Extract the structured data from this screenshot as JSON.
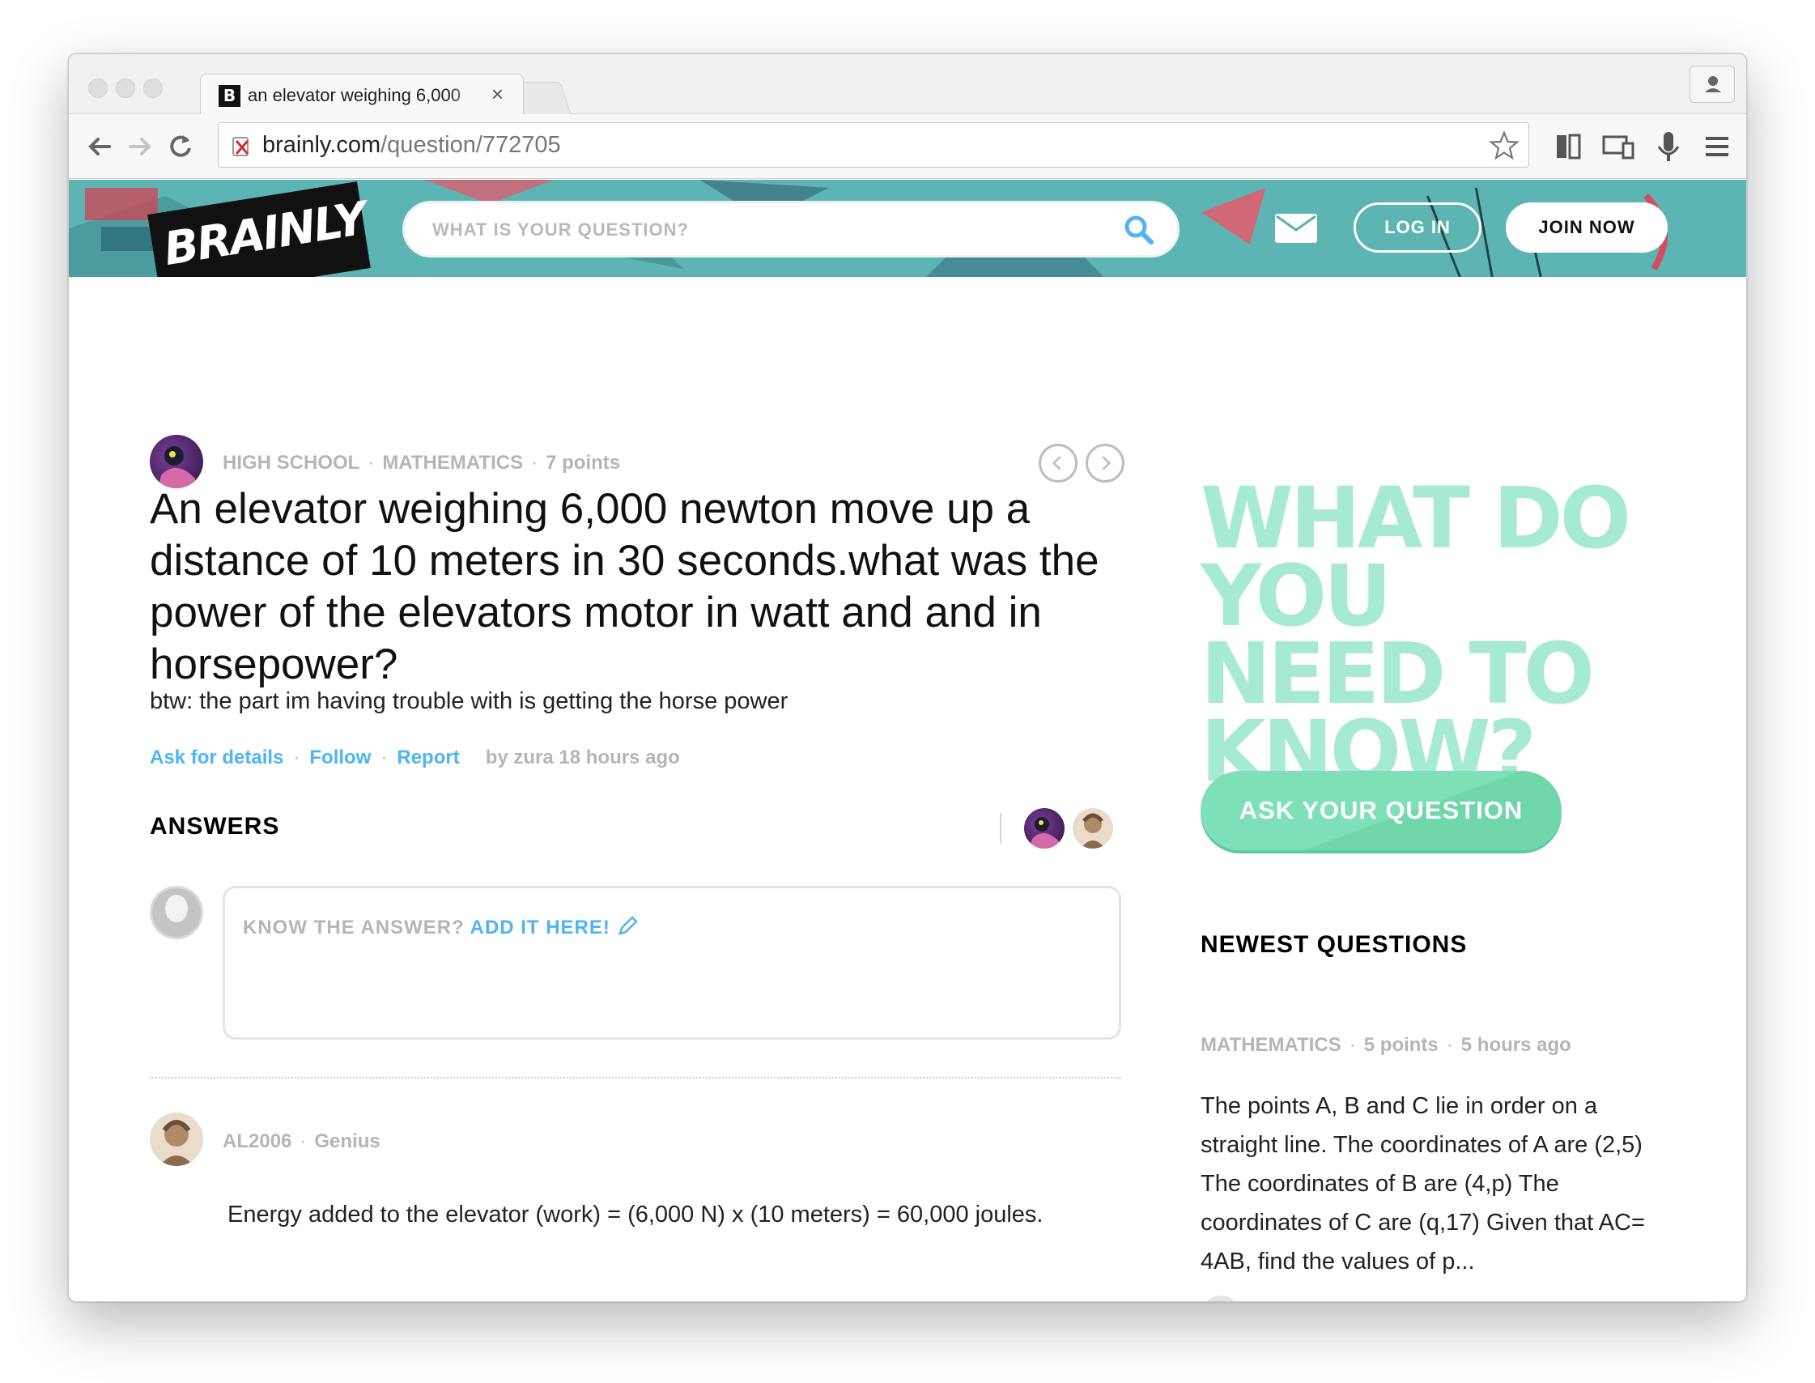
{
  "browser": {
    "tab_title": "an elevator weighing 6,000",
    "tab_favicon": "B",
    "tab_close": "×",
    "url_host": "brainly.com",
    "url_path": "/question/772705"
  },
  "header": {
    "logo": "BRAINLY",
    "search_placeholder": "WHAT IS YOUR QUESTION?",
    "login_label": "LOG IN",
    "join_label": "JOIN NOW"
  },
  "question": {
    "level": "HIGH SCHOOL",
    "subject": "MATHEMATICS",
    "points": "7 points",
    "title": "An elevator weighing 6,000 newton move up a distance of 10 meters in 30 seconds.what was the power of the elevators motor in watt and and in horsepower?",
    "subtitle": "btw: the part im having trouble with is getting the horse power",
    "actions": {
      "ask_details": "Ask for details",
      "follow": "Follow",
      "report": "Report",
      "by_line": "by zura 18 hours ago"
    }
  },
  "answers": {
    "heading": "ANSWERS",
    "prompt_grey": "KNOW THE ANSWER?",
    "prompt_blue": "ADD IT HERE!",
    "answer_user": "AL2006",
    "answer_rank": "Genius",
    "answer_text": "Energy added to the elevator (work) = (6,000 N) x (10 meters) = 60,000 joules."
  },
  "sidebar": {
    "headline": [
      "WHAT DO",
      "YOU",
      "NEED TO",
      "KNOW?"
    ],
    "ask_button": "ASK YOUR QUESTION",
    "newest_heading": "NEWEST QUESTIONS",
    "newest_subject": "MATHEMATICS",
    "newest_points": "5 points",
    "newest_time": "5 hours ago",
    "newest_text": "The points A, B and C lie in order on a straight line. The coordinates of A are (2,5) The coordinates of B are (4,p) The coordinates of C are (q,17) Given that AC= 4AB, find the values of p..."
  },
  "colors": {
    "brand_teal": "#58b0ae",
    "link_blue": "#4fb3f6",
    "mint": "#a6ead1",
    "ask_green": "#7ee0b6"
  },
  "icons": [
    "back-icon",
    "forward-icon",
    "reload-icon",
    "insecure-icon",
    "star-icon",
    "search-icon",
    "mail-icon",
    "chevron-left-icon",
    "chevron-right-icon",
    "pencil-icon"
  ]
}
